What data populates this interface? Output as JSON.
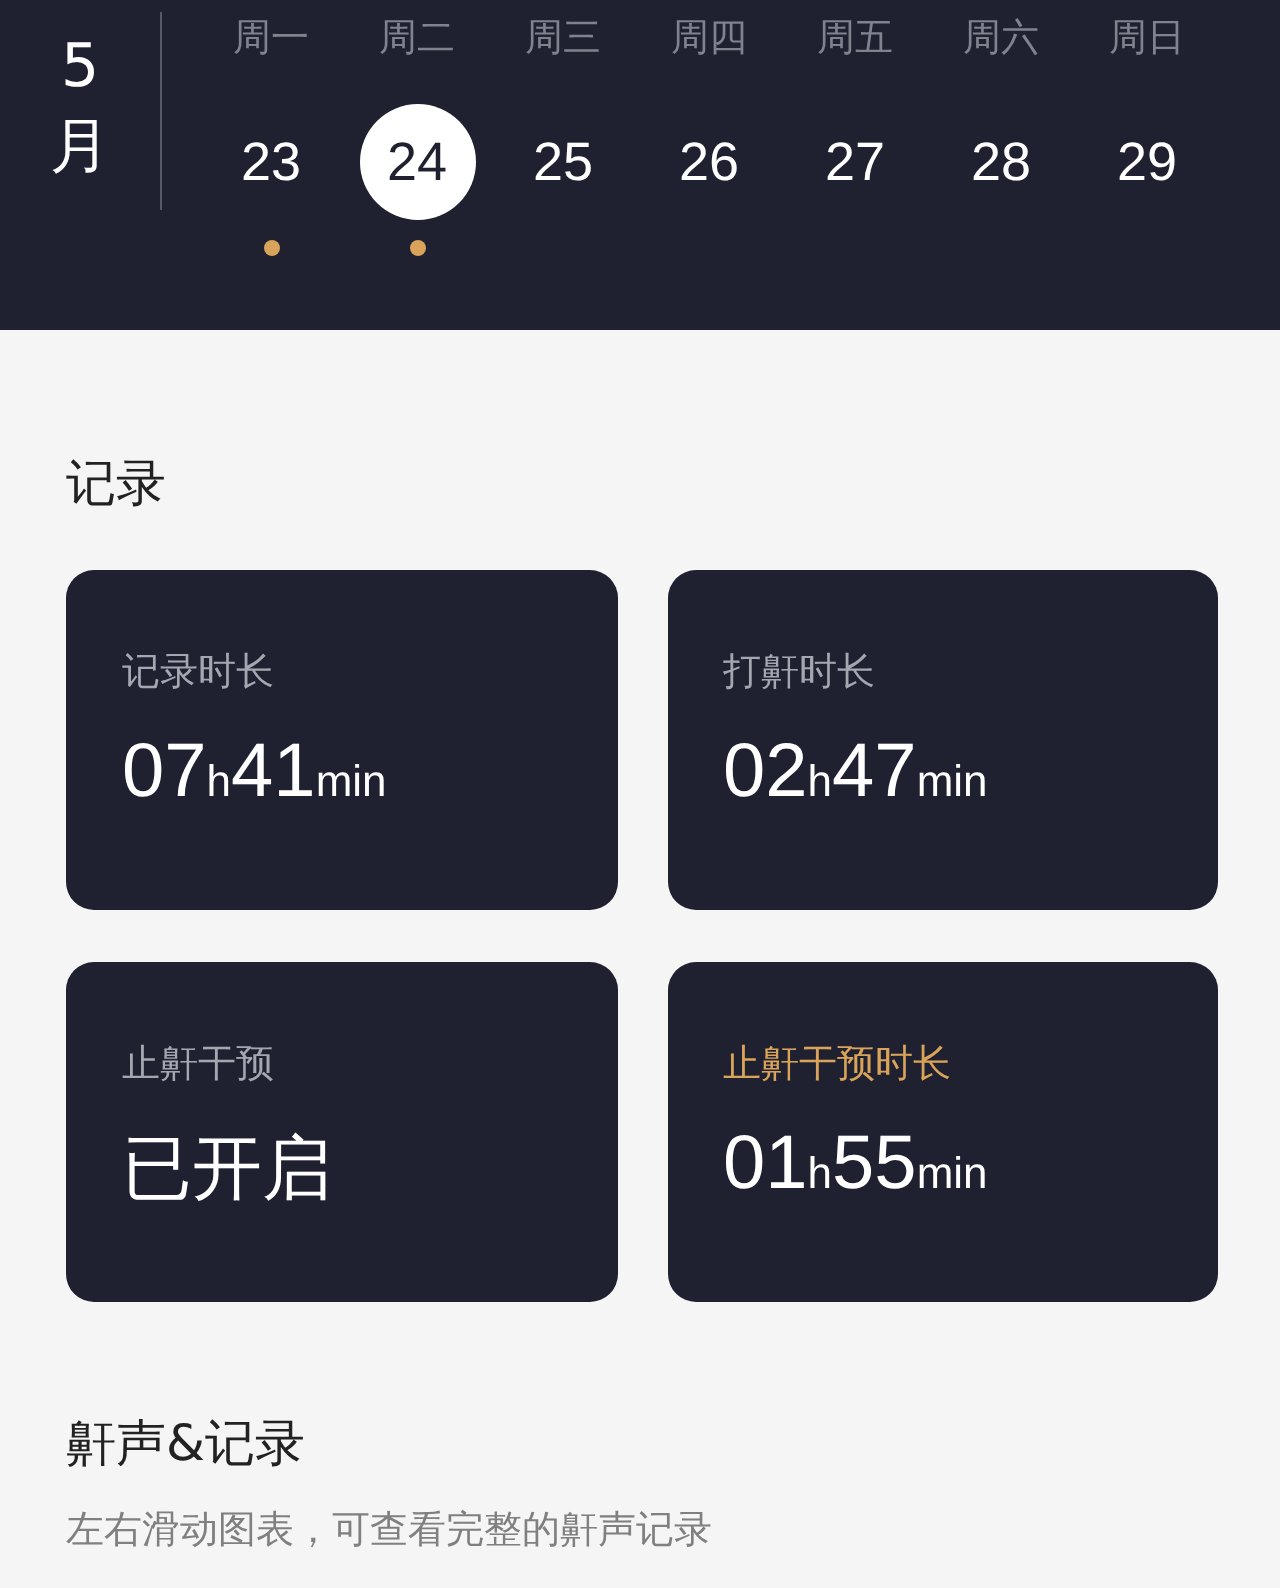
{
  "calendar": {
    "month_number": "5",
    "month_unit": "月",
    "days": [
      {
        "weekday": "周一",
        "date": "23",
        "selected": false,
        "marked": true
      },
      {
        "weekday": "周二",
        "date": "24",
        "selected": true,
        "marked": true
      },
      {
        "weekday": "周三",
        "date": "25",
        "selected": false,
        "marked": false
      },
      {
        "weekday": "周四",
        "date": "26",
        "selected": false,
        "marked": false
      },
      {
        "weekday": "周五",
        "date": "27",
        "selected": false,
        "marked": false
      },
      {
        "weekday": "周六",
        "date": "28",
        "selected": false,
        "marked": false
      },
      {
        "weekday": "周日",
        "date": "29",
        "selected": false,
        "marked": false
      }
    ]
  },
  "records": {
    "title": "记录",
    "cards": [
      {
        "label": "记录时长",
        "highlighted": false,
        "kind": "duration",
        "hours": "07",
        "hours_unit": "h",
        "minutes": "41",
        "minutes_unit": "min"
      },
      {
        "label": "打鼾时长",
        "highlighted": false,
        "kind": "duration",
        "hours": "02",
        "hours_unit": "h",
        "minutes": "47",
        "minutes_unit": "min"
      },
      {
        "label": "止鼾干预",
        "highlighted": false,
        "kind": "text",
        "value": "已开启"
      },
      {
        "label": "止鼾干预时长",
        "highlighted": true,
        "kind": "duration",
        "hours": "01",
        "hours_unit": "h",
        "minutes": "55",
        "minutes_unit": "min"
      }
    ]
  },
  "snore_section": {
    "title": "鼾声&记录",
    "subtitle": "左右滑动图表，可查看完整的鼾声记录"
  }
}
